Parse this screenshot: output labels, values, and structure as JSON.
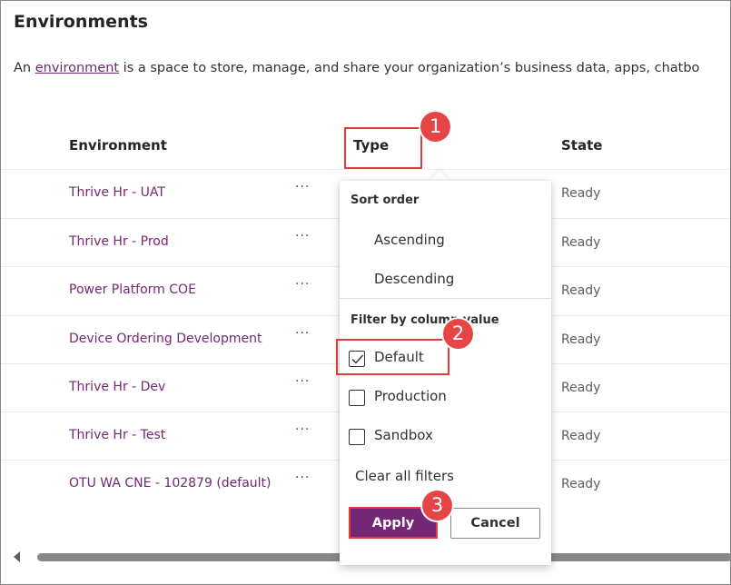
{
  "page": {
    "title": "Environments",
    "intro_prefix": "An ",
    "intro_link": "environment",
    "intro_suffix": " is a space to store, manage, and share your organization’s business data, apps, chatbo"
  },
  "table": {
    "columns": [
      "Environment",
      "Type",
      "State"
    ],
    "more_glyph": "···",
    "rows": [
      {
        "name": "Thrive Hr - UAT",
        "state": "Ready"
      },
      {
        "name": "Thrive Hr - Prod",
        "state": "Ready"
      },
      {
        "name": "Power Platform COE",
        "state": "Ready"
      },
      {
        "name": "Device Ordering Development",
        "state": "Ready"
      },
      {
        "name": "Thrive Hr - Dev",
        "state": "Ready"
      },
      {
        "name": "Thrive Hr - Test",
        "state": "Ready"
      },
      {
        "name": "OTU WA CNE - 102879 (default)",
        "state": "Ready"
      }
    ]
  },
  "dropdown": {
    "sort_label": "Sort order",
    "sort_options": [
      "Ascending",
      "Descending"
    ],
    "filter_label": "Filter by column value",
    "filters": [
      {
        "label": "Default",
        "checked": true
      },
      {
        "label": "Production",
        "checked": false
      },
      {
        "label": "Sandbox",
        "checked": false
      }
    ],
    "clear_label": "Clear all filters",
    "apply_label": "Apply",
    "cancel_label": "Cancel"
  },
  "annotations": {
    "badges": [
      "1",
      "2",
      "3"
    ],
    "color": "#e64545"
  },
  "colors": {
    "accent": "#742774",
    "annotation": "#e03c3c"
  }
}
